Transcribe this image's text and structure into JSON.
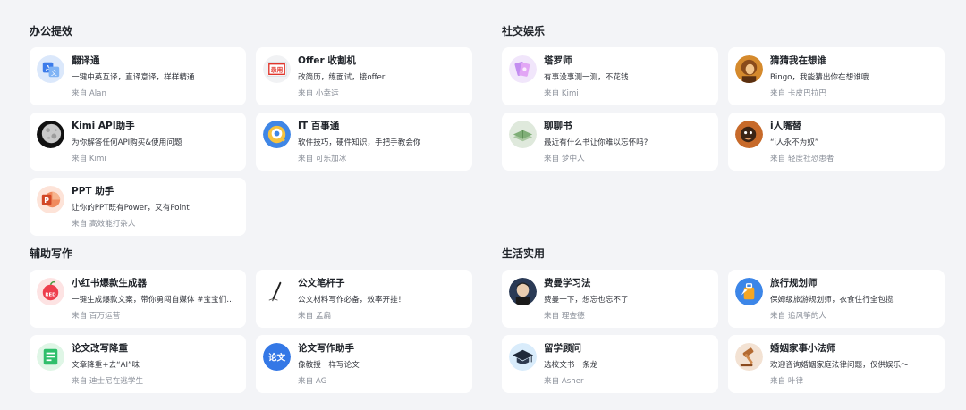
{
  "sections": [
    {
      "title": "办公提效",
      "cards": [
        {
          "name": "翻译通",
          "desc": "一键中英互译，直译意译，样样精通",
          "author": "来自 Alan",
          "icon": "translate-icon"
        },
        {
          "name": "Offer 收割机",
          "desc": "改简历，练面试，接offer",
          "author": "来自 小幸运",
          "icon": "offer-stamp-icon"
        },
        {
          "name": "Kimi API助手",
          "desc": "为你解答任何API购买&使用问题",
          "author": "来自 Kimi",
          "icon": "moon-icon"
        },
        {
          "name": "IT 百事通",
          "desc": "软件技巧，硬件知识，手把手教会你",
          "author": "来自 可乐加冰",
          "icon": "it-helper-icon"
        },
        {
          "name": "PPT 助手",
          "desc": "让你的PPT既有Power，又有Point",
          "author": "来自 高效能打杂人",
          "icon": "ppt-icon"
        }
      ]
    },
    {
      "title": "社交娱乐",
      "cards": [
        {
          "name": "塔罗师",
          "desc": "有事没事测一测，不花钱",
          "author": "来自 Kimi",
          "icon": "tarot-cards-icon"
        },
        {
          "name": "猜猜我在想谁",
          "desc": "Bingo，我能猜出你在想谁哦",
          "author": "来自 卡皮巴拉巴",
          "icon": "guess-portrait-icon"
        },
        {
          "name": "聊聊书",
          "desc": "最近有什么书让你难以忘怀吗?",
          "author": "来自 梦中人",
          "icon": "book-icon"
        },
        {
          "name": "i人嘴替",
          "desc": "“i人永不为奴”",
          "author": "来自 轻度社恐患者",
          "icon": "i-person-icon"
        }
      ]
    },
    {
      "title": "辅助写作",
      "cards": [
        {
          "name": "小红书爆款生成器",
          "desc": "一键生成爆款文案，带你勇闯自媒体 #宝宝们都在看",
          "author": "来自 百万运营",
          "icon": "red-apple-icon"
        },
        {
          "name": "公文笔杆子",
          "desc": "公文材料写作必备，效率开挂！",
          "author": "来自 孟扁",
          "icon": "pen-icon"
        },
        {
          "name": "论文改写降重",
          "desc": "文章降重+去“AI”味",
          "author": "来自 迪士尼在逃学生",
          "icon": "rewrite-doc-icon"
        },
        {
          "name": "论文写作助手",
          "desc": "像教授一样写论文",
          "author": "来自 AG",
          "icon": "thesis-icon"
        }
      ]
    },
    {
      "title": "生活实用",
      "cards": [
        {
          "name": "费曼学习法",
          "desc": "费曼一下，想忘也忘不了",
          "author": "来自 理查德",
          "icon": "feynman-portrait-icon"
        },
        {
          "name": "旅行规划师",
          "desc": "保姆级旅游规划师，衣食住行全包揽",
          "author": "来自 追风筝的人",
          "icon": "suitcase-icon"
        },
        {
          "name": "留学顾问",
          "desc": "选校文书一条龙",
          "author": "来自 Asher",
          "icon": "graduation-cap-icon"
        },
        {
          "name": "婚姻家事小法师",
          "desc": "欢迎咨询婚姻家庭法律问题，仅供娱乐～",
          "author": "来自 叶律",
          "icon": "gavel-icon"
        }
      ]
    }
  ]
}
